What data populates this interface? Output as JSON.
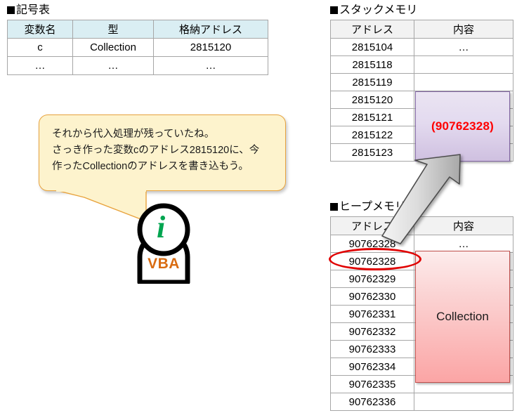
{
  "sections": {
    "symbol_table_title": "記号表",
    "stack_memory_title": "スタックメモリ",
    "heap_memory_title": "ヒープメモリ"
  },
  "symbol_table": {
    "headers": [
      "変数名",
      "型",
      "格納アドレス"
    ],
    "rows": [
      [
        "c",
        "Collection",
        "2815120"
      ],
      [
        "…",
        "…",
        "…"
      ]
    ]
  },
  "stack_memory": {
    "headers": [
      "アドレス",
      "内容"
    ],
    "rows": [
      {
        "address": "2815104",
        "content": "…"
      },
      {
        "address": "2815118",
        "content": ""
      },
      {
        "address": "2815119",
        "content": ""
      },
      {
        "address": "2815120",
        "content": ""
      },
      {
        "address": "2815121",
        "content": ""
      },
      {
        "address": "2815122",
        "content": ""
      },
      {
        "address": "2815123",
        "content": ""
      }
    ],
    "value_box_label": "(90762328)",
    "value_box_color": "#8064a2",
    "value_box_text_color": "#ff0000"
  },
  "heap_memory": {
    "headers": [
      "アドレス",
      "内容"
    ],
    "rows": [
      {
        "address": "90762328",
        "content": "…"
      },
      {
        "address": "90762328",
        "content": ""
      },
      {
        "address": "90762329",
        "content": ""
      },
      {
        "address": "90762330",
        "content": ""
      },
      {
        "address": "90762331",
        "content": ""
      },
      {
        "address": "90762332",
        "content": ""
      },
      {
        "address": "90762333",
        "content": ""
      },
      {
        "address": "90762334",
        "content": ""
      },
      {
        "address": "90762335",
        "content": ""
      },
      {
        "address": "90762336",
        "content": ""
      }
    ],
    "value_box_label": "Collection",
    "value_box_color": "#c0504d",
    "highlight_color": "#e00000",
    "highlighted_address": "90762328"
  },
  "speech_bubble": {
    "lines": [
      "それから代入処理が残っていたね。",
      "さっき作った変数cのアドレス2815120に、今",
      "作ったCollectionのアドレスを書き込もう。"
    ],
    "fill_color": "#fdf3cd",
    "border_color": "#e8a33d"
  },
  "mascot": {
    "head_glyph": "i",
    "body_label": "VBA",
    "head_color": "#00a550",
    "body_label_color": "#d96c12"
  },
  "arrow": {
    "name": "heap-to-stack-arrow",
    "color": "#d9d9d9",
    "direction": "up-right"
  }
}
